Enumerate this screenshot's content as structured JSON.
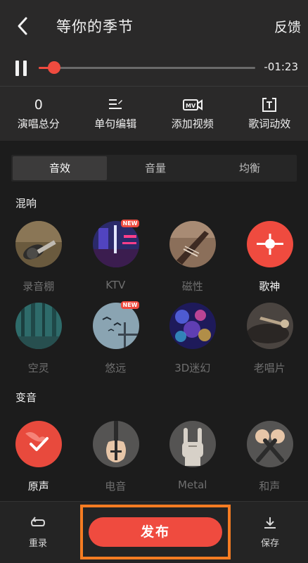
{
  "header": {
    "title": "等你的季节",
    "feedback_label": "反馈",
    "back_icon": "chevron-left-icon"
  },
  "player": {
    "state_icon": "pause-icon",
    "progress": 0.07,
    "time_remaining": "-01:23",
    "colors": {
      "accent": "#ef4b3f"
    }
  },
  "tools": [
    {
      "value": "0",
      "label": "演唱总分"
    },
    {
      "icon": "edit-lines-icon",
      "label": "单句编辑"
    },
    {
      "icon": "mv-camera-icon",
      "label": "添加视频"
    },
    {
      "icon": "lyric-t-icon",
      "label": "歌词动效"
    }
  ],
  "tabs": [
    {
      "label": "音效",
      "active": true
    },
    {
      "label": "音量",
      "active": false
    },
    {
      "label": "均衡",
      "active": false
    }
  ],
  "reverb": {
    "section_label": "混响",
    "items": [
      {
        "label": "录音棚",
        "badge": "",
        "selected": false
      },
      {
        "label": "KTV",
        "badge": "NEW",
        "selected": false
      },
      {
        "label": "磁性",
        "badge": "",
        "selected": false
      },
      {
        "label": "歌神",
        "badge": "",
        "selected": true
      },
      {
        "label": "空灵",
        "badge": "",
        "selected": false
      },
      {
        "label": "悠远",
        "badge": "NEW",
        "selected": false
      },
      {
        "label": "3D迷幻",
        "badge": "",
        "selected": false
      },
      {
        "label": "老唱片",
        "badge": "",
        "selected": false
      }
    ]
  },
  "voice_change": {
    "section_label": "变音",
    "items": [
      {
        "label": "原声",
        "selected": true
      },
      {
        "label": "电音",
        "selected": false
      },
      {
        "label": "Metal",
        "selected": false
      },
      {
        "label": "和声",
        "selected": false
      }
    ]
  },
  "bottom_bar": {
    "redo_label": "重录",
    "publish_label": "发布",
    "save_label": "保存",
    "redo_icon": "rerecord-loop-icon",
    "save_icon": "download-icon"
  }
}
